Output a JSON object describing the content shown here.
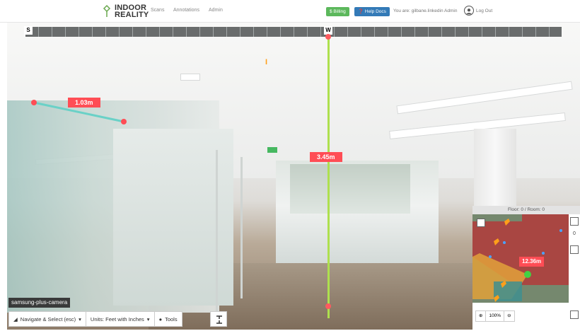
{
  "header": {
    "logo_line1": "INDOOR",
    "logo_line2": "REALITY",
    "nav": [
      "Scans",
      "Annotations",
      "Admin"
    ],
    "billing_label": "$ Billing",
    "help_label": "❓ Help Docs",
    "user_text": "You are: gilbane.linkedin Admin",
    "logout_label": "Log Out"
  },
  "viewer": {
    "compass_start": "S",
    "compass_current": "W",
    "measure_left": "1.03m",
    "measure_vertical": "3.45m",
    "camera_name": "samsung-plus-camera"
  },
  "toolbar": {
    "mode_label": "Navigate & Select (esc)",
    "units_label": "Units: Feet with Inches",
    "tools_label": "Tools"
  },
  "minimap": {
    "title": "Floor: 0 / Room: 0",
    "measure": "12.36m",
    "level": "0",
    "zoom_value": "100%"
  },
  "colors": {
    "accent_green": "#aee04e",
    "measure_red": "#ff4d55",
    "billing_green": "#5cb85c",
    "help_blue": "#337ab7",
    "marker_orange": "#ff9f1a"
  }
}
